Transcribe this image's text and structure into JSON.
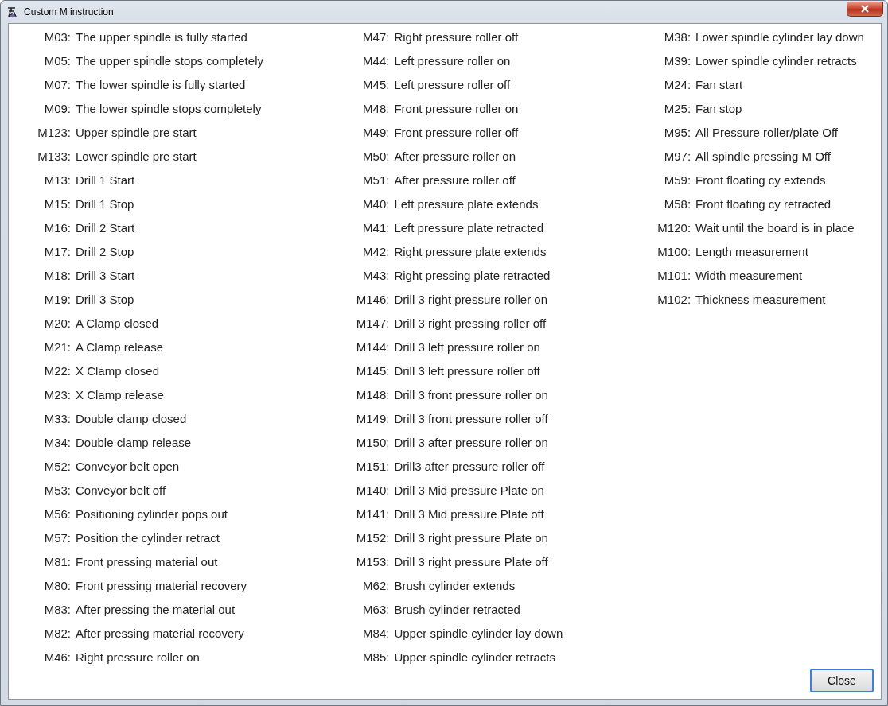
{
  "window": {
    "title": "Custom M instruction"
  },
  "columns": [
    [
      {
        "code": "M03:",
        "text": "The upper spindle is fully started"
      },
      {
        "code": "M05:",
        "text": "The upper spindle stops completely"
      },
      {
        "code": "M07:",
        "text": "The lower spindle is fully started"
      },
      {
        "code": "M09:",
        "text": "The lower spindle stops completely"
      },
      {
        "code": "M123:",
        "text": "Upper spindle pre start"
      },
      {
        "code": "M133:",
        "text": "Lower spindle pre start"
      },
      {
        "code": "M13:",
        "text": "Drill 1 Start"
      },
      {
        "code": "M15:",
        "text": "Drill 1 Stop"
      },
      {
        "code": "M16:",
        "text": "Drill 2 Start"
      },
      {
        "code": "M17:",
        "text": "Drill 2 Stop"
      },
      {
        "code": "M18:",
        "text": "Drill 3 Start"
      },
      {
        "code": "M19:",
        "text": "Drill 3 Stop"
      },
      {
        "code": "M20:",
        "text": "A Clamp closed"
      },
      {
        "code": "M21:",
        "text": "A Clamp release"
      },
      {
        "code": "M22:",
        "text": "X Clamp closed"
      },
      {
        "code": "M23:",
        "text": "X Clamp release"
      },
      {
        "code": "M33:",
        "text": "Double clamp closed"
      },
      {
        "code": "M34:",
        "text": "Double clamp release"
      },
      {
        "code": "M52:",
        "text": "Conveyor belt open"
      },
      {
        "code": "M53:",
        "text": "Conveyor belt off"
      },
      {
        "code": "M56:",
        "text": "Positioning cylinder pops out"
      },
      {
        "code": "M57:",
        "text": "Position the cylinder retract"
      },
      {
        "code": "M81:",
        "text": "Front pressing material out"
      },
      {
        "code": "M80:",
        "text": "Front pressing material recovery"
      },
      {
        "code": "M83:",
        "text": "After pressing the material out"
      },
      {
        "code": "M82:",
        "text": "After pressing material recovery"
      },
      {
        "code": "M46:",
        "text": "Right pressure roller on"
      }
    ],
    [
      {
        "code": "M47:",
        "text": "Right pressure roller off"
      },
      {
        "code": "M44:",
        "text": "Left pressure roller on"
      },
      {
        "code": "M45:",
        "text": "Left pressure roller off"
      },
      {
        "code": "M48:",
        "text": "Front pressure roller on"
      },
      {
        "code": "M49:",
        "text": "Front pressure roller off"
      },
      {
        "code": "M50:",
        "text": "After pressure roller on"
      },
      {
        "code": "M51:",
        "text": "After pressure roller off"
      },
      {
        "code": "M40:",
        "text": "Left pressure plate extends"
      },
      {
        "code": "M41:",
        "text": "Left pressure plate retracted"
      },
      {
        "code": "M42:",
        "text": "Right pressure plate extends"
      },
      {
        "code": "M43:",
        "text": "Right pressing plate retracted"
      },
      {
        "code": "M146:",
        "text": "Drill 3 right pressure roller on"
      },
      {
        "code": "M147:",
        "text": "Drill 3 right pressing roller off"
      },
      {
        "code": "M144:",
        "text": "Drill 3 left pressure roller on"
      },
      {
        "code": "M145:",
        "text": "Drill 3 left pressure roller off"
      },
      {
        "code": "M148:",
        "text": "Drill 3 front pressure roller on"
      },
      {
        "code": "M149:",
        "text": "Drill 3 front pressure roller off"
      },
      {
        "code": "M150:",
        "text": "Drill 3 after pressure roller on"
      },
      {
        "code": "M151:",
        "text": "Drill3 after pressure roller off"
      },
      {
        "code": "M140:",
        "text": "Drill 3 Mid pressure Plate on"
      },
      {
        "code": "M141:",
        "text": "Drill 3 Mid pressure Plate off"
      },
      {
        "code": "M152:",
        "text": "Drill 3 right pressure Plate on"
      },
      {
        "code": "M153:",
        "text": "Drill 3 right pressure Plate off"
      },
      {
        "code": "M62:",
        "text": "Brush cylinder extends"
      },
      {
        "code": "M63:",
        "text": "Brush cylinder retracted"
      },
      {
        "code": "M84:",
        "text": "Upper spindle cylinder lay down"
      },
      {
        "code": "M85:",
        "text": "Upper spindle cylinder retracts"
      }
    ],
    [
      {
        "code": "M38:",
        "text": "Lower spindle cylinder lay down"
      },
      {
        "code": "M39:",
        "text": "Lower spindle cylinder retracts"
      },
      {
        "code": "M24:",
        "text": "Fan start"
      },
      {
        "code": "M25:",
        "text": "Fan stop"
      },
      {
        "code": "M95:",
        "text": "All Pressure roller/plate Off"
      },
      {
        "code": "M97:",
        "text": "All spindle pressing M Off"
      },
      {
        "code": "M59:",
        "text": "Front floating cy extends"
      },
      {
        "code": "M58:",
        "text": "Front floating cy retracted"
      },
      {
        "code": "M120:",
        "text": "Wait until the board is in place"
      },
      {
        "code": "M100:",
        "text": "Length measurement"
      },
      {
        "code": "M101:",
        "text": "Width measurement"
      },
      {
        "code": "M102:",
        "text": "Thickness measurement"
      }
    ]
  ],
  "buttons": [
    {
      "label": "Close"
    }
  ]
}
